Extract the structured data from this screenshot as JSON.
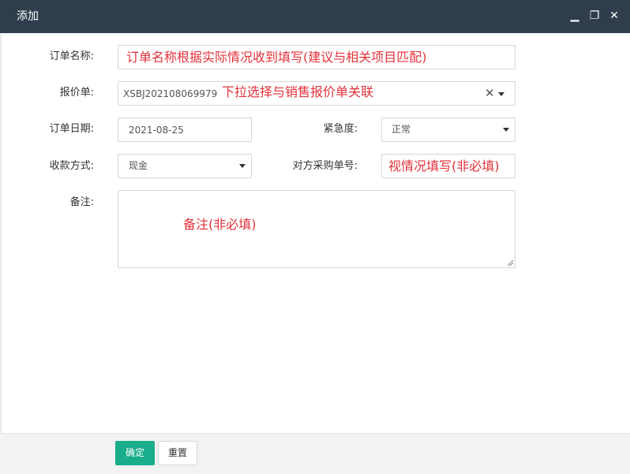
{
  "dialog": {
    "title": "添加"
  },
  "window_controls": {
    "minimize": "▁",
    "maximize": "❐",
    "close": "✕"
  },
  "form": {
    "order_name": {
      "label": "订单名称:",
      "hint": "订单名称根据实际情况收到填写(建议与相关项目匹配)"
    },
    "quote": {
      "label": "报价单:",
      "value": "XSBJ202108069979",
      "hint": "下拉选择与销售报价单关联"
    },
    "order_date": {
      "label": "订单日期:",
      "value": "2021-08-25"
    },
    "urgency": {
      "label": "紧急度:",
      "value": "正常"
    },
    "payment": {
      "label": "收款方式:",
      "value": "现金"
    },
    "po_number": {
      "label": "对方采购单号:",
      "hint": "视情况填写(非必填)"
    },
    "remark": {
      "label": "备注:",
      "hint": "备注(非必填)"
    }
  },
  "footer": {
    "confirm_label": "确定",
    "reset_label": "重置"
  },
  "colors": {
    "titlebar": "#2f3d4c",
    "accent": "#1aad8c",
    "annotation": "#e2323b"
  },
  "icons": {
    "clear": "close-icon",
    "dropdown": "caret-down-icon"
  }
}
